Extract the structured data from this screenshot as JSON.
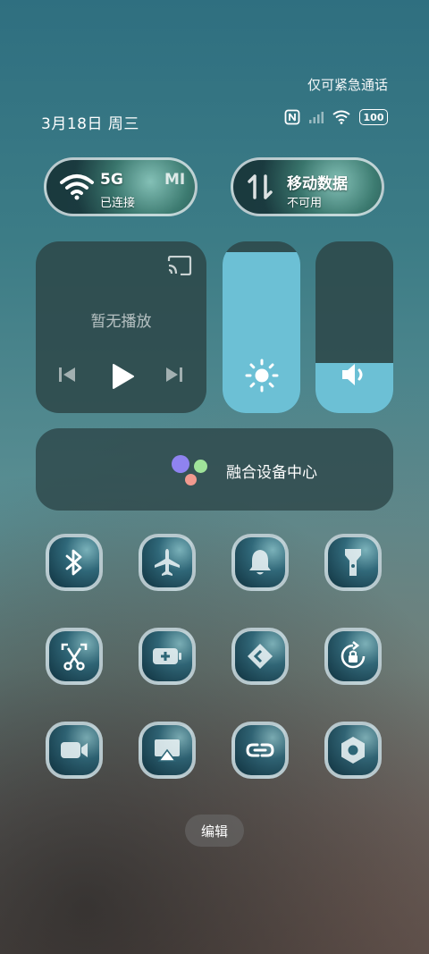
{
  "status": {
    "emergency_text": "仅可紧急通话",
    "date": "3月18日 周三",
    "battery": "100"
  },
  "wifi": {
    "title": "5G",
    "subtitle": "已连接",
    "extra": "MI"
  },
  "mobile_data": {
    "title": "移动数据",
    "subtitle": "不可用"
  },
  "media": {
    "status": "暂无播放"
  },
  "sliders": {
    "brightness_level": 0.94,
    "volume_level": 0.29
  },
  "device_hub": {
    "label": "融合设备中心"
  },
  "toggles": [
    {
      "icon": "bluetooth-icon"
    },
    {
      "icon": "airplane-icon"
    },
    {
      "icon": "bell-icon"
    },
    {
      "icon": "flashlight-icon"
    },
    {
      "icon": "screenshot-icon"
    },
    {
      "icon": "battery-saver-icon"
    },
    {
      "icon": "nearby-share-icon"
    },
    {
      "icon": "rotation-lock-icon"
    },
    {
      "icon": "screen-record-icon"
    },
    {
      "icon": "screen-cast-icon"
    },
    {
      "icon": "link-icon"
    },
    {
      "icon": "settings-icon"
    }
  ],
  "edit_label": "编辑",
  "colors": {
    "accent": "#6cc0d5",
    "dot_purple": "#8f83f0",
    "dot_green": "#9fe39a",
    "dot_pink": "#f29a8f"
  }
}
